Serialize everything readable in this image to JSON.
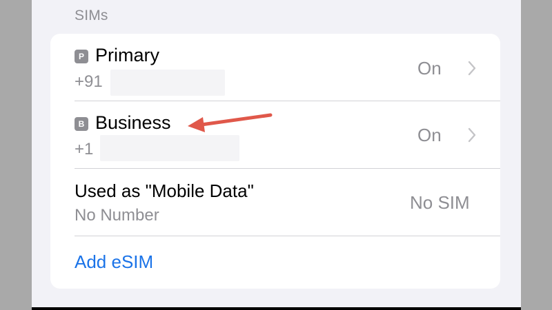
{
  "section": {
    "header": "SIMs"
  },
  "sims": [
    {
      "badge": "P",
      "label": "Primary",
      "number": "+91",
      "value": "On"
    },
    {
      "badge": "B",
      "label": "Business",
      "number": "+1",
      "value": "On"
    }
  ],
  "mobile_data": {
    "label": "Used as \"Mobile Data\"",
    "subtitle": "No Number",
    "value": "No SIM"
  },
  "add_esim": {
    "label": "Add eSIM"
  },
  "colors": {
    "link": "#1a73e8",
    "annotation_arrow": "#e0584a",
    "badge": "#8e8e93"
  }
}
